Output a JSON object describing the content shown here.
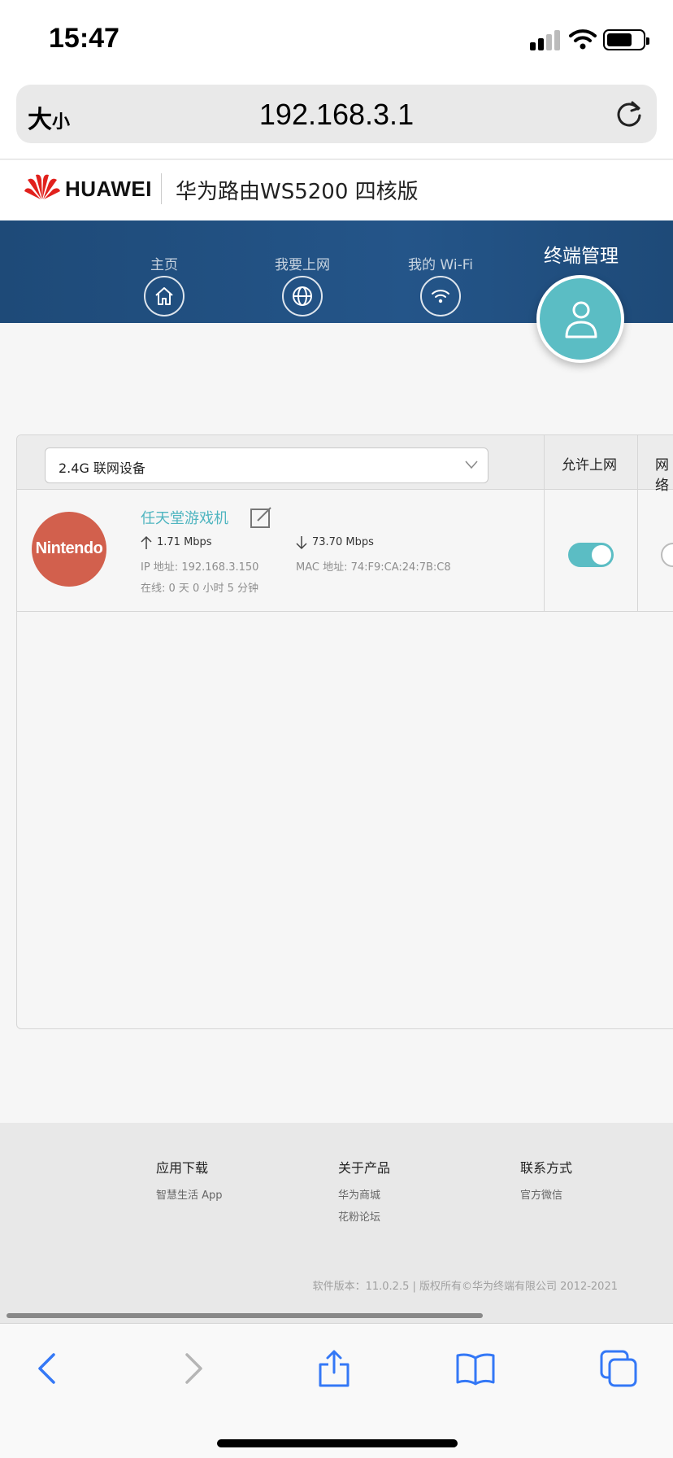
{
  "status_bar": {
    "time": "15:47"
  },
  "browser": {
    "text_size_big": "大",
    "text_size_small": "小",
    "url": "192.168.3.1"
  },
  "brand": {
    "company": "HUAWEI",
    "product": "华为路由WS5200 四核版"
  },
  "nav": {
    "items": [
      {
        "label": "主页",
        "icon": "home-icon"
      },
      {
        "label": "我要上网",
        "icon": "globe-icon"
      },
      {
        "label": "我的 Wi-Fi",
        "icon": "wifi-icon"
      }
    ],
    "active": {
      "label": "终端管理",
      "icon": "user-icon"
    }
  },
  "device_panel": {
    "band_selector": "2.4G 联网设备",
    "columns": [
      "允许上网",
      "网络"
    ],
    "devices": [
      {
        "avatar_text": "Nintendo",
        "name": "任天堂游戏机",
        "upload": "1.71 Mbps",
        "download": "73.70 Mbps",
        "ip": "IP 地址: 192.168.3.150",
        "mac": "MAC 地址: 74:F9:CA:24:7B:C8",
        "online": "在线: 0 天 0 小时 5 分钟",
        "allow_internet": true
      }
    ]
  },
  "footer": {
    "columns": [
      {
        "title": "应用下载",
        "links": [
          "智慧生活 App"
        ]
      },
      {
        "title": "关于产品",
        "links": [
          "华为商城",
          "花粉论坛"
        ]
      },
      {
        "title": "联系方式",
        "links": [
          "官方微信"
        ]
      }
    ],
    "copyright": "软件版本：11.0.2.5 |  版权所有©华为终端有限公司 2012-2021"
  },
  "colors": {
    "nav_bg": "#245589",
    "accent": "#5bbdc4",
    "avatar_bg": "#d2604d",
    "ios_blue": "#3478f6"
  }
}
